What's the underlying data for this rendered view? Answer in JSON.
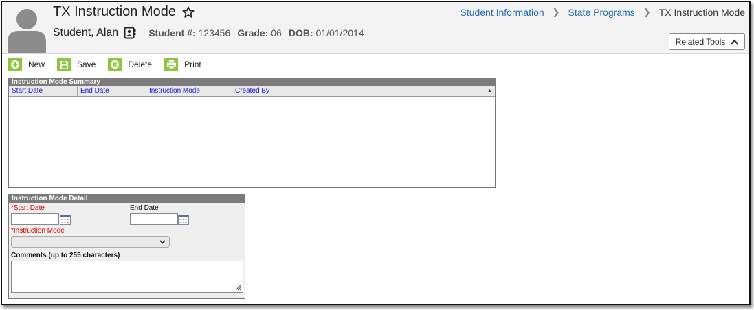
{
  "header": {
    "page_title": "TX Instruction Mode",
    "student_name": "Student, Alan",
    "student_num_label": "Student #:",
    "student_num": "123456",
    "grade_label": "Grade:",
    "grade": "06",
    "dob_label": "DOB:",
    "dob": "01/01/2014",
    "related_tools_label": "Related Tools"
  },
  "breadcrumb": {
    "items": [
      "Student Information",
      "State Programs",
      "TX Instruction Mode"
    ]
  },
  "toolbar": {
    "new_label": "New",
    "save_label": "Save",
    "delete_label": "Delete",
    "print_label": "Print"
  },
  "summary": {
    "title": "Instruction Mode Summary",
    "columns": [
      "Start Date",
      "End Date",
      "Instruction Mode",
      "Created By"
    ],
    "rows": []
  },
  "detail": {
    "title": "Instruction Mode Detail",
    "start_date_label": "*Start Date",
    "start_date_value": "",
    "end_date_label": "End Date",
    "end_date_value": "",
    "instruction_mode_label": "*Instruction Mode",
    "instruction_mode_value": "",
    "comments_label": "Comments (up to 255 characters)",
    "comments_value": ""
  },
  "colors": {
    "accent_green": "#8dc63f",
    "link_blue": "#2a6fb0",
    "required_red": "#d40000",
    "panel_header": "#7b7b7b"
  },
  "icons": [
    "avatar-icon",
    "star-icon",
    "contact-card-icon",
    "chevron-right-icon",
    "chevron-up-icon",
    "plus-icon",
    "save-icon",
    "delete-icon",
    "print-icon",
    "sort-arrow-icon",
    "calendar-icon",
    "dropdown-chevron-icon",
    "resize-grip-icon"
  ]
}
